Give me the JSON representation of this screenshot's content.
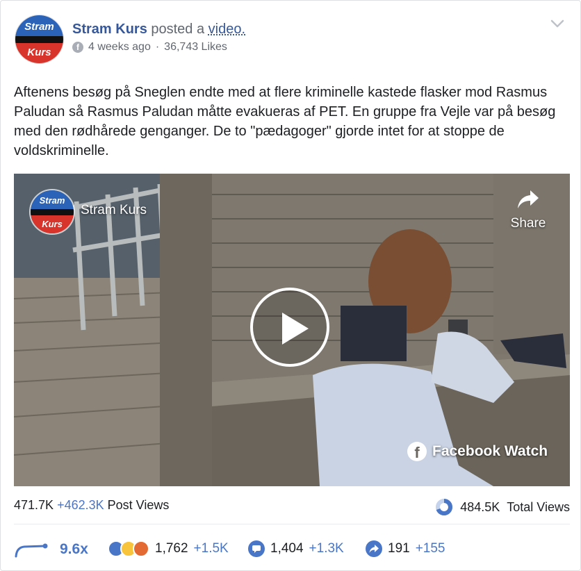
{
  "header": {
    "page_name": "Stram Kurs",
    "posted_text": "posted a",
    "video_link": "video.",
    "time_ago": "4 weeks ago",
    "separator": "·",
    "likes": "36,743 Likes",
    "avatar_text_top": "Stram",
    "avatar_text_bottom": "Kurs",
    "avatar_colors": {
      "top": "#2a63b7",
      "middle": "#111111",
      "bottom": "#d9342b"
    }
  },
  "post": {
    "text": "Aftenens besøg på Sneglen endte med at flere kriminelle kastede flasker mod Rasmus Paludan så Rasmus Paludan måtte evakueras af PET. En gruppe fra Vejle var på besøg med den rødhårede genganger. De to \"pædagoger\" gjorde intet for at stoppe de voldskriminelle."
  },
  "video": {
    "channel_name": "Stram Kurs",
    "share_label": "Share",
    "watch_label": "Facebook Watch",
    "play_icon": "play-icon"
  },
  "stats": {
    "post_views_base": "471.7K",
    "post_views_increase": "+462.3K",
    "post_views_label": "Post Views",
    "total_views": "484.5K",
    "total_views_label": "Total Views",
    "multiplier": "9.6x",
    "reactions": "1,762",
    "reactions_increase": "+1.5K",
    "comments": "1,404",
    "comments_increase": "+1.3K",
    "shares": "191",
    "shares_increase": "+155",
    "accent_color": "#4a76c7"
  }
}
